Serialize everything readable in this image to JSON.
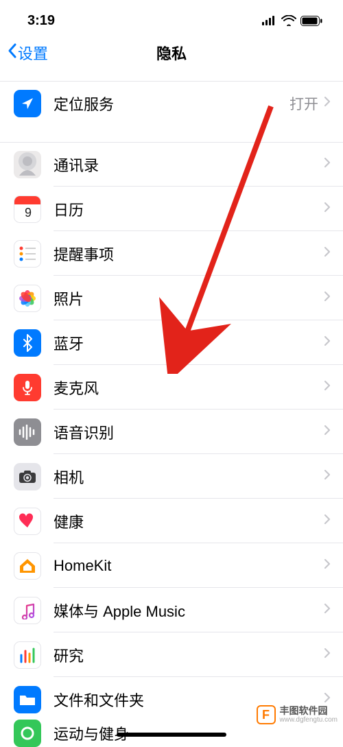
{
  "statusBar": {
    "time": "3:19"
  },
  "nav": {
    "back": "设置",
    "title": "隐私"
  },
  "rows": {
    "location": {
      "label": "定位服务",
      "value": "打开"
    },
    "contacts": {
      "label": "通讯录"
    },
    "calendar": {
      "label": "日历"
    },
    "reminders": {
      "label": "提醒事项"
    },
    "photos": {
      "label": "照片"
    },
    "bluetooth": {
      "label": "蓝牙"
    },
    "microphone": {
      "label": "麦克风"
    },
    "speech": {
      "label": "语音识别"
    },
    "camera": {
      "label": "相机"
    },
    "health": {
      "label": "健康"
    },
    "homekit": {
      "label": "HomeKit"
    },
    "media": {
      "label": "媒体与 Apple Music"
    },
    "research": {
      "label": "研究"
    },
    "files": {
      "label": "文件和文件夹"
    },
    "fitness": {
      "label": "运动与健身"
    }
  },
  "watermark": {
    "logo": "F",
    "line1": "丰图软件园",
    "line2": "www.dgfengtu.com"
  }
}
